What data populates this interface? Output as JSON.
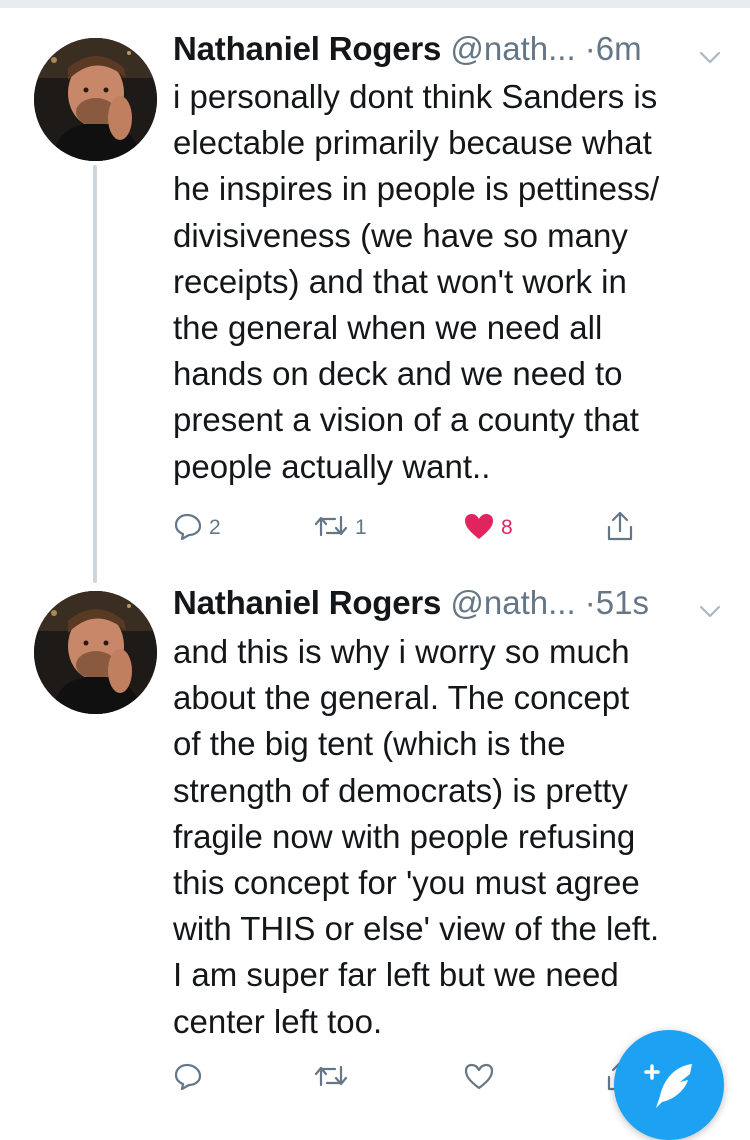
{
  "tweets": [
    {
      "author_name": "Nathaniel Rogers",
      "handle": "@nath...",
      "separator": "·",
      "time": "6m",
      "lines": [
        "i personally dont think Sanders is",
        "electable primarily because what",
        "he inspires in people is pettiness/",
        "divisiveness (we have so many",
        "receipts) and that won't work in",
        "the general when we need all",
        "hands on deck and we need to",
        "present a vision of a county that",
        "people actually want.."
      ],
      "replies": "2",
      "retweets": "1",
      "likes": "8",
      "liked": true
    },
    {
      "author_name": "Nathaniel Rogers",
      "handle": "@nath...",
      "separator": "·",
      "time": "51s",
      "lines": [
        "and this is why i worry so much",
        "about the general. The concept",
        "of the big tent (which is the",
        "strength of democrats) is pretty",
        "fragile now with people refusing",
        "this concept for 'you must agree",
        "with THIS or else' view of the left.",
        "I am super far left but we need",
        "center left too."
      ],
      "replies": "",
      "retweets": "",
      "likes": "",
      "liked": false
    }
  ],
  "icons": {
    "reply": "reply-icon",
    "retweet": "retweet-icon",
    "like": "heart-icon",
    "share": "share-icon",
    "caret": "chevron-down-icon",
    "compose": "compose-tweet-icon"
  },
  "colors": {
    "accent": "#1da1f2",
    "like": "#e0245e",
    "secondary_text": "#657786",
    "thread_line": "#ccd6dd"
  }
}
